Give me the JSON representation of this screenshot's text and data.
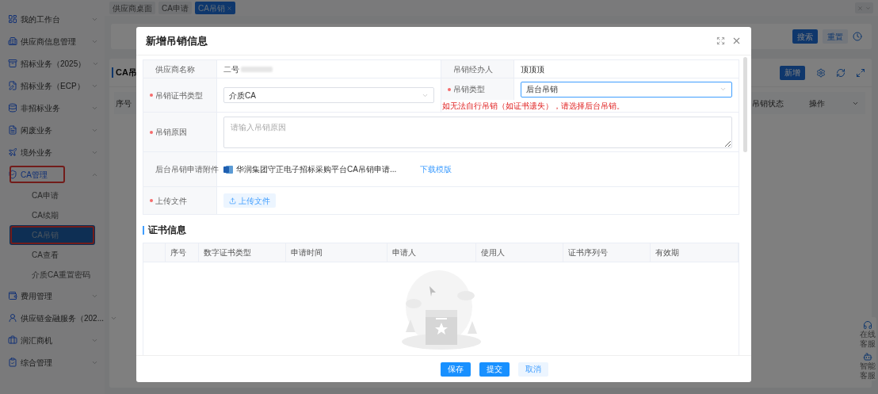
{
  "tabs": [
    {
      "label": "供应商桌面",
      "selected": false,
      "closable": false
    },
    {
      "label": "CA申请",
      "selected": false,
      "closable": false
    },
    {
      "label": "CA吊销",
      "selected": true,
      "closable": true
    }
  ],
  "sidebar": {
    "items": [
      {
        "label": "我的工作台",
        "expanded": false,
        "highlighted": false
      },
      {
        "label": "供应商信息管理",
        "expanded": false,
        "highlighted": false
      },
      {
        "label": "招标业务（2025）",
        "expanded": false,
        "highlighted": false
      },
      {
        "label": "招标业务（ECP）",
        "expanded": false,
        "highlighted": false
      },
      {
        "label": "非招标业务",
        "expanded": false,
        "highlighted": false
      },
      {
        "label": "闲废业务",
        "expanded": false,
        "highlighted": false
      },
      {
        "label": "境外业务",
        "expanded": false,
        "highlighted": false
      },
      {
        "label": "CA管理",
        "expanded": true,
        "highlighted": true,
        "children": [
          {
            "label": "CA申请",
            "selected": false,
            "highlighted": false
          },
          {
            "label": "CA续期",
            "selected": false,
            "highlighted": false
          },
          {
            "label": "CA吊销",
            "selected": true,
            "highlighted": true
          },
          {
            "label": "CA查看",
            "selected": false,
            "highlighted": false
          },
          {
            "label": "介质CA重置密码",
            "selected": false,
            "highlighted": false
          }
        ]
      },
      {
        "label": "费用管理",
        "expanded": false,
        "highlighted": false
      },
      {
        "label": "供应链金融服务（202...",
        "expanded": false,
        "highlighted": false
      },
      {
        "label": "润汇商机",
        "expanded": false,
        "highlighted": false
      },
      {
        "label": "综合管理",
        "expanded": false,
        "highlighted": false
      }
    ]
  },
  "search_panel": {
    "buttons": [
      "搜索",
      "重置"
    ]
  },
  "list_panel": {
    "title": "CA吊",
    "buttons": [
      "新增"
    ],
    "columns": [
      "序号",
      "吊销状态",
      "操作"
    ]
  },
  "modal": {
    "title": "新增吊销信息",
    "form": {
      "supplier_name": {
        "label": "供应商名称",
        "value": "二号",
        "required": false
      },
      "handler": {
        "label": "吊销经办人",
        "value": "顶顶顶",
        "required": false
      },
      "cert_type": {
        "label": "吊销证书类型",
        "value": "介质CA",
        "required": true
      },
      "revoke_type": {
        "label": "吊销类型",
        "value": "后台吊销",
        "required": true,
        "focused": true
      },
      "hint": "如无法自行吊销（如证书遗失），请选择后台吊销。",
      "reason": {
        "label": "吊销原因",
        "placeholder": "请输入吊销原因",
        "required": true
      },
      "attachment": {
        "label": "后台吊销申请附件",
        "file": "华润集团守正电子招标采购平台CA吊销申请...",
        "link": "下载模版",
        "required": false
      },
      "upload": {
        "label": "上传文件",
        "button": "上传文件",
        "required": true
      }
    },
    "section_title": "证书信息",
    "table": {
      "columns": [
        "序号",
        "数字证书类型",
        "申请时间",
        "申请人",
        "使用人",
        "证书序列号",
        "有效期"
      ]
    },
    "buttons": [
      {
        "label": "保存",
        "kind": "primary"
      },
      {
        "label": "提交",
        "kind": "primary"
      },
      {
        "label": "取消",
        "kind": "secondary"
      }
    ]
  },
  "float_widget": [
    {
      "label": "在线客服"
    },
    {
      "label": "智能客服"
    }
  ]
}
